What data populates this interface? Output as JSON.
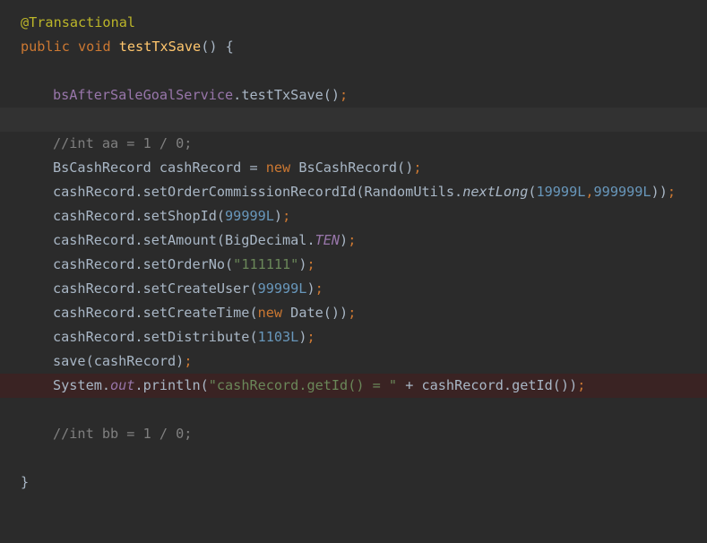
{
  "code": {
    "l1": {
      "annotation": "@Transactional"
    },
    "l2": {
      "kw_public": "public",
      "kw_void": "void",
      "method": "testTxSave",
      "rest": "() {"
    },
    "l4": {
      "field": "bsAfterSaleGoalService",
      "call": ".testTxSave()",
      "semi": ";"
    },
    "l6": {
      "comment": "//int aa = 1 / 0;"
    },
    "l7": {
      "p1": "BsCashRecord cashRecord = ",
      "kw_new": "new",
      "p2": " BsCashRecord()",
      "semi": ";"
    },
    "l8": {
      "p1": "cashRecord.setOrderCommissionRecordId(RandomUtils.",
      "static_call": "nextLong",
      "p2": "(",
      "n1": "19999L",
      "comma": ",",
      "n2": "999999L",
      "p3": "))",
      "semi": ";"
    },
    "l9": {
      "p1": "cashRecord.setShopId(",
      "n": "99999L",
      "p2": ")",
      "semi": ";"
    },
    "l10": {
      "p1": "cashRecord.setAmount(BigDecimal.",
      "static_field": "TEN",
      "p2": ")",
      "semi": ";"
    },
    "l11": {
      "p1": "cashRecord.setOrderNo(",
      "str": "\"111111\"",
      "p2": ")",
      "semi": ";"
    },
    "l12": {
      "p1": "cashRecord.setCreateUser(",
      "n": "99999L",
      "p2": ")",
      "semi": ";"
    },
    "l13": {
      "p1": "cashRecord.setCreateTime(",
      "kw_new": "new",
      "p2": " Date())",
      "semi": ";"
    },
    "l14": {
      "p1": "cashRecord.setDistribute(",
      "n": "1103L",
      "p2": ")",
      "semi": ";"
    },
    "l15": {
      "p1": "save(cashRecord)",
      "semi": ";"
    },
    "l16": {
      "p1": "System.",
      "static_field": "out",
      "p2": ".println(",
      "str": "\"cashRecord.getId() = \"",
      "p3": " + cashRecord.getId())",
      "semi": ";"
    },
    "l18": {
      "comment": "//int bb = 1 / 0;"
    },
    "l20": {
      "brace": "}"
    }
  },
  "colors": {
    "background": "#2b2b2b",
    "current_line": "#323232",
    "breakpoint_line": "#3a2323",
    "keyword": "#cc7832",
    "annotation": "#bbb529",
    "method_decl": "#ffc66d",
    "field": "#9876aa",
    "number": "#6897bb",
    "string": "#6a8759",
    "comment": "#808080",
    "text": "#a9b7c6"
  }
}
